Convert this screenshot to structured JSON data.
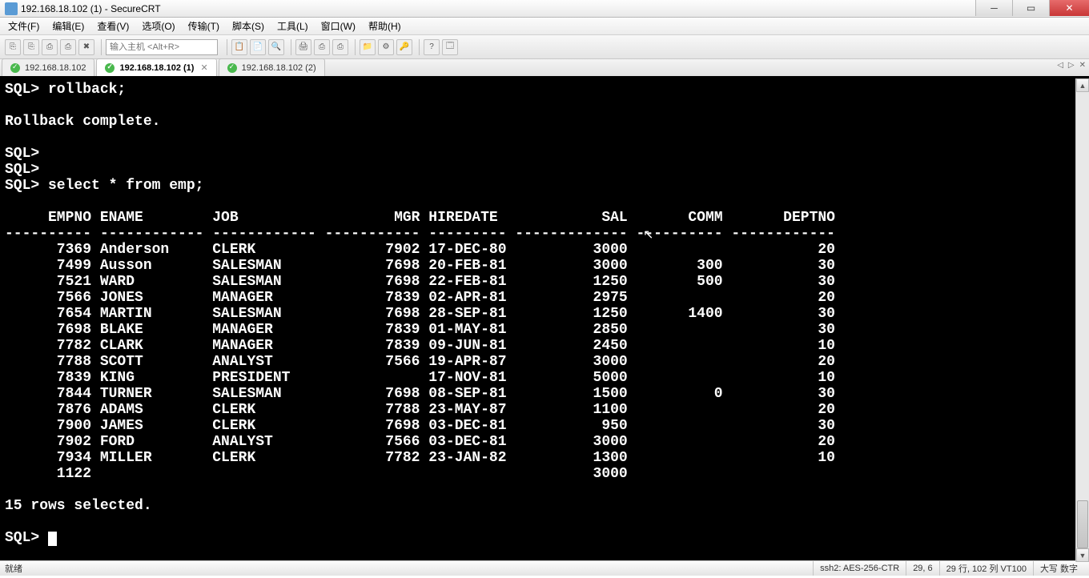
{
  "window": {
    "title": "192.168.18.102 (1) - SecureCRT"
  },
  "menu": {
    "file": "文件(F)",
    "edit": "编辑(E)",
    "view": "查看(V)",
    "options": "选项(O)",
    "transfer": "传输(T)",
    "script": "脚本(S)",
    "tools": "工具(L)",
    "window": "窗口(W)",
    "help": "帮助(H)"
  },
  "toolbar": {
    "host_placeholder": "输入主机 <Alt+R>"
  },
  "tabs": [
    {
      "label": "192.168.18.102",
      "active": false,
      "closable": false
    },
    {
      "label": "192.168.18.102 (1)",
      "active": true,
      "closable": true
    },
    {
      "label": "192.168.18.102 (2)",
      "active": false,
      "closable": false
    }
  ],
  "terminal": {
    "lines": [
      "SQL> rollback;",
      "",
      "Rollback complete.",
      "",
      "SQL> ",
      "SQL> ",
      "SQL> select * from emp;",
      "",
      "     EMPNO ENAME        JOB                  MGR HIREDATE            SAL       COMM       DEPTNO",
      "---------- ------------ ------------ ----------- --------- ------------- ---------- ------------",
      "      7369 Anderson     CLERK               7902 17-DEC-80          3000                      20",
      "      7499 Ausson       SALESMAN            7698 20-FEB-81          3000        300           30",
      "      7521 WARD         SALESMAN            7698 22-FEB-81          1250        500           30",
      "      7566 JONES        MANAGER             7839 02-APR-81          2975                      20",
      "      7654 MARTIN       SALESMAN            7698 28-SEP-81          1250       1400           30",
      "      7698 BLAKE        MANAGER             7839 01-MAY-81          2850                      30",
      "      7782 CLARK        MANAGER             7839 09-JUN-81          2450                      10",
      "      7788 SCOTT        ANALYST             7566 19-APR-87          3000                      20",
      "      7839 KING         PRESIDENT                17-NOV-81          5000                      10",
      "      7844 TURNER       SALESMAN            7698 08-SEP-81          1500          0           30",
      "      7876 ADAMS        CLERK               7788 23-MAY-87          1100                      20",
      "      7900 JAMES        CLERK               7698 03-DEC-81           950                      30",
      "      7902 FORD         ANALYST             7566 03-DEC-81          3000                      20",
      "      7934 MILLER       CLERK               7782 23-JAN-82          1300                      10",
      "      1122                                                          3000",
      "",
      "15 rows selected.",
      "",
      "SQL> "
    ]
  },
  "chart_data": {
    "type": "table",
    "title": "select * from emp;",
    "columns": [
      "EMPNO",
      "ENAME",
      "JOB",
      "MGR",
      "HIREDATE",
      "SAL",
      "COMM",
      "DEPTNO"
    ],
    "rows": [
      [
        7369,
        "Anderson",
        "CLERK",
        7902,
        "17-DEC-80",
        3000,
        null,
        20
      ],
      [
        7499,
        "Ausson",
        "SALESMAN",
        7698,
        "20-FEB-81",
        3000,
        300,
        30
      ],
      [
        7521,
        "WARD",
        "SALESMAN",
        7698,
        "22-FEB-81",
        1250,
        500,
        30
      ],
      [
        7566,
        "JONES",
        "MANAGER",
        7839,
        "02-APR-81",
        2975,
        null,
        20
      ],
      [
        7654,
        "MARTIN",
        "SALESMAN",
        7698,
        "28-SEP-81",
        1250,
        1400,
        30
      ],
      [
        7698,
        "BLAKE",
        "MANAGER",
        7839,
        "01-MAY-81",
        2850,
        null,
        30
      ],
      [
        7782,
        "CLARK",
        "MANAGER",
        7839,
        "09-JUN-81",
        2450,
        null,
        10
      ],
      [
        7788,
        "SCOTT",
        "ANALYST",
        7566,
        "19-APR-87",
        3000,
        null,
        20
      ],
      [
        7839,
        "KING",
        "PRESIDENT",
        null,
        "17-NOV-81",
        5000,
        null,
        10
      ],
      [
        7844,
        "TURNER",
        "SALESMAN",
        7698,
        "08-SEP-81",
        1500,
        0,
        30
      ],
      [
        7876,
        "ADAMS",
        "CLERK",
        7788,
        "23-MAY-87",
        1100,
        null,
        20
      ],
      [
        7900,
        "JAMES",
        "CLERK",
        7698,
        "03-DEC-81",
        950,
        null,
        30
      ],
      [
        7902,
        "FORD",
        "ANALYST",
        7566,
        "03-DEC-81",
        3000,
        null,
        20
      ],
      [
        7934,
        "MILLER",
        "CLERK",
        7782,
        "23-JAN-82",
        1300,
        null,
        10
      ],
      [
        1122,
        null,
        null,
        null,
        null,
        3000,
        null,
        null
      ]
    ],
    "row_count_message": "15 rows selected."
  },
  "status": {
    "ready": "就绪",
    "conn": "ssh2: AES-256-CTR",
    "pos": "29,   6",
    "size": "29 行, 102 列 VT100",
    "caps": "大写 数字"
  }
}
